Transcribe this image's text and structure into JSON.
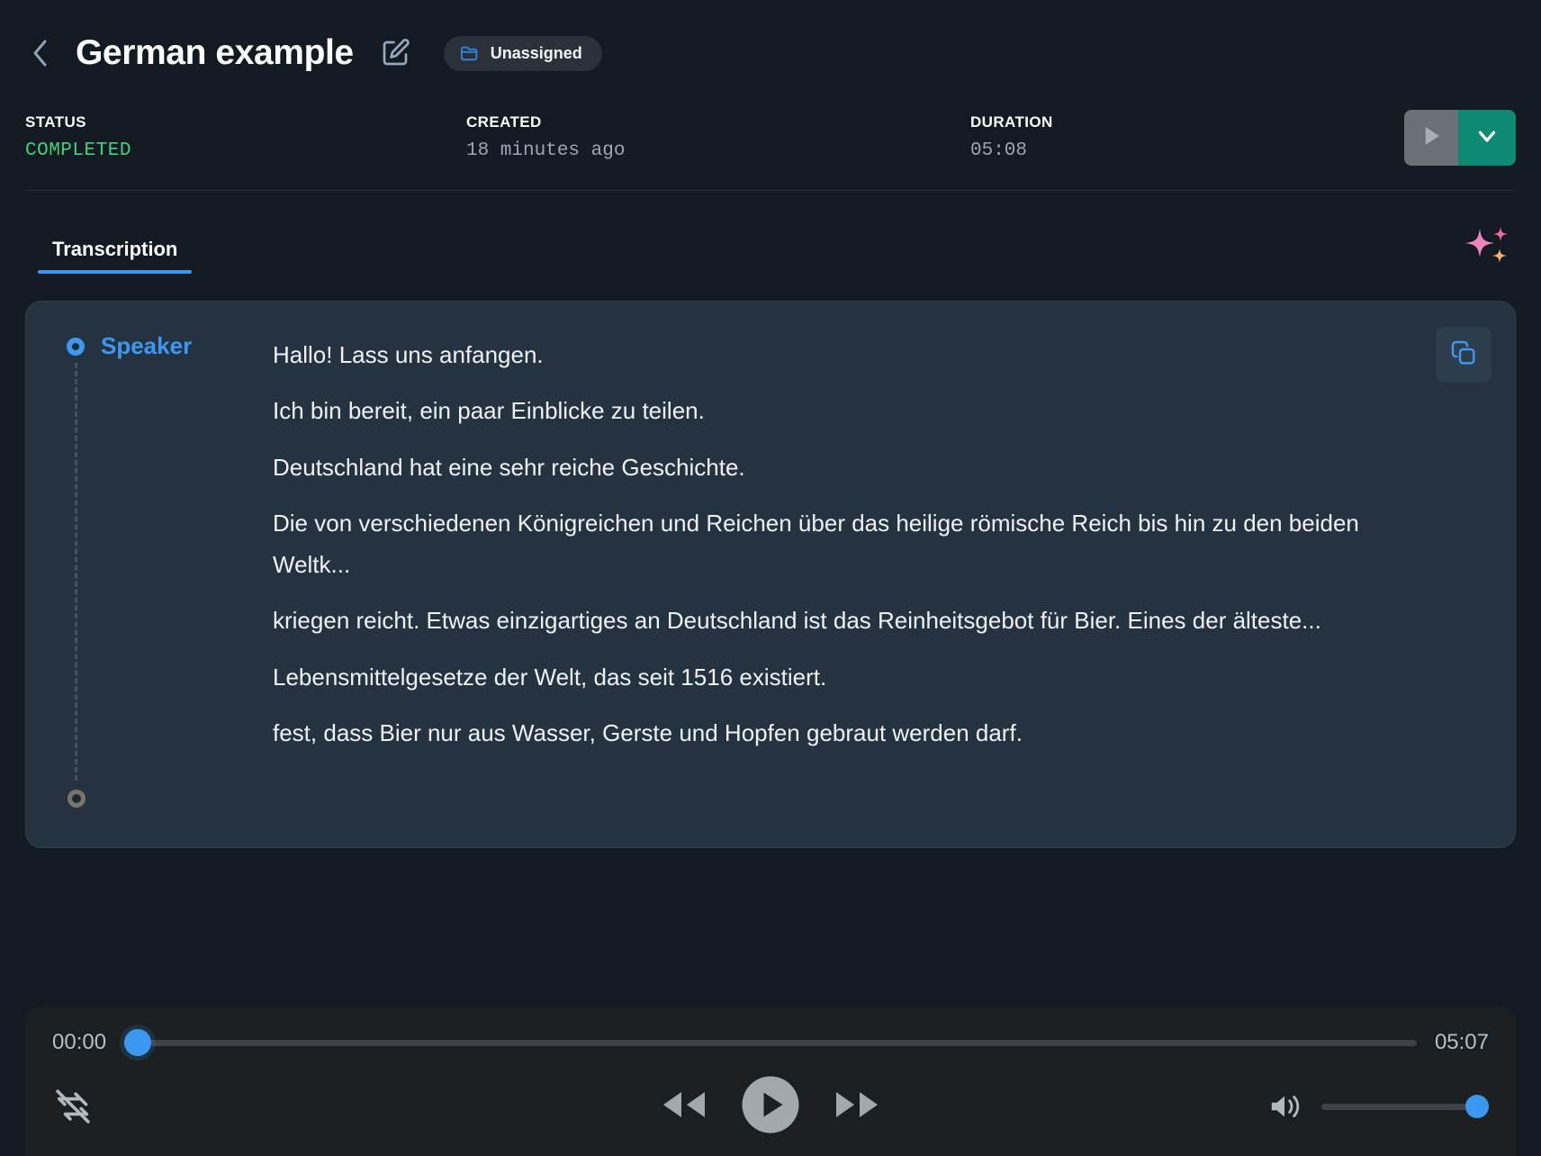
{
  "header": {
    "back_icon": "chevron-left-icon",
    "title": "German example",
    "edit_icon": "pencil-edit-icon",
    "folder_icon": "folder-icon",
    "folder_label": "Unassigned"
  },
  "meta": {
    "status_label": "STATUS",
    "status_value": "COMPLETED",
    "status_color": "#3fd37f",
    "created_label": "CREATED",
    "created_value": "18 minutes ago",
    "duration_label": "DURATION",
    "duration_value": "05:08"
  },
  "actions": {
    "play_icon": "play-icon",
    "caret_icon": "chevron-down-icon",
    "caret_color": "#0f8a72"
  },
  "tabs": [
    {
      "label": "Transcription",
      "active": true
    }
  ],
  "ai": {
    "sparkle_icon": "sparkles-icon"
  },
  "transcript": {
    "speaker_name": "Speaker",
    "speaker_color": "#3b97ef",
    "copy_icon": "copy-icon",
    "lines": [
      "Hallo! Lass uns anfangen.",
      "Ich bin bereit, ein paar Einblicke zu teilen.",
      "Deutschland hat eine sehr reiche Geschichte.",
      "Die von verschiedenen Königreichen und Reichen über das heilige römische Reich bis hin zu den beiden Weltk...",
      "kriegen reicht. Etwas einzigartiges an Deutschland ist das Reinheitsgebot für Bier. Eines der älteste...",
      "Lebensmittelgesetze der Welt, das seit 1516 existiert.",
      "fest, dass Bier nur aus Wasser, Gerste und Hopfen gebraut werden darf."
    ]
  },
  "player": {
    "current_time": "00:00",
    "total_time": "05:07",
    "progress_percent": 0,
    "volume_percent": 100,
    "repeat_icon": "repeat-off-icon",
    "rewind_icon": "rewind-icon",
    "play_icon": "play-circle-icon",
    "forward_icon": "fast-forward-icon",
    "volume_icon": "volume-up-icon",
    "accent_color": "#3b97ef"
  }
}
